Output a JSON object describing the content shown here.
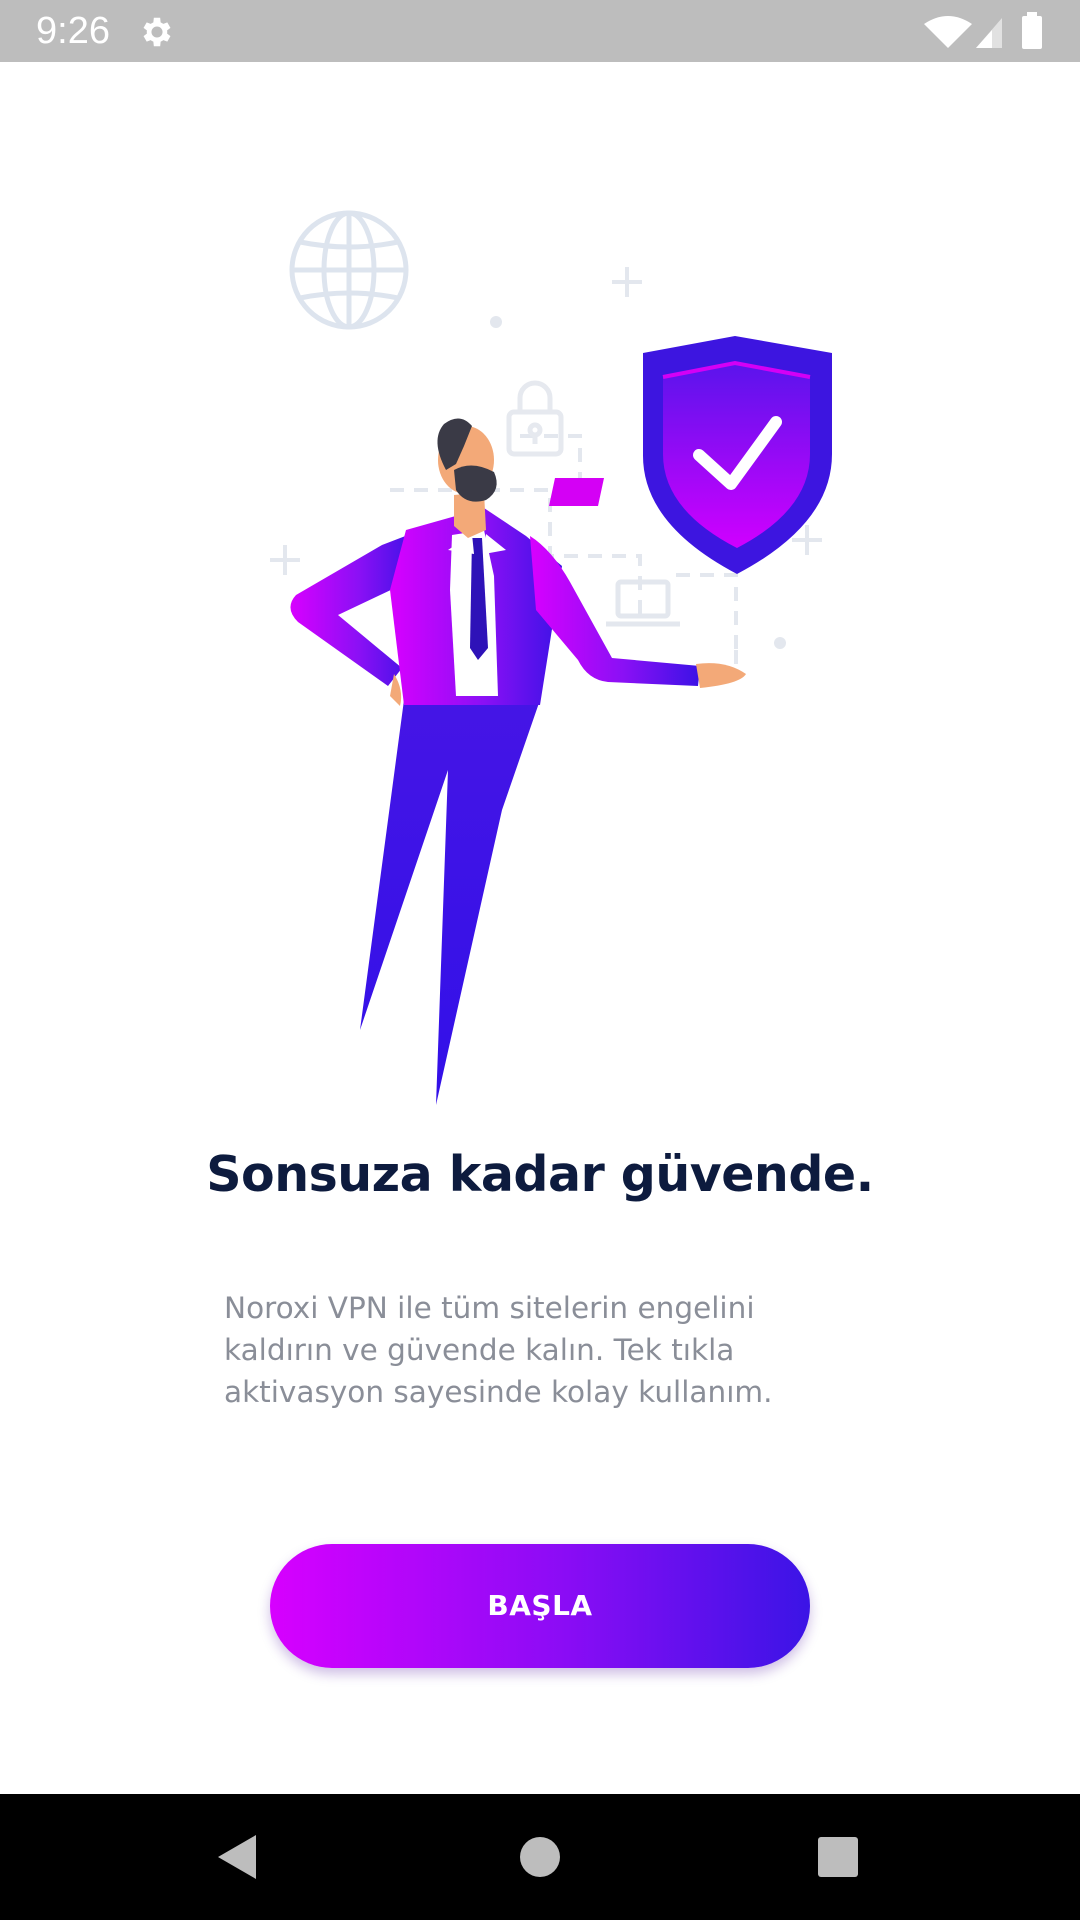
{
  "status_bar": {
    "time": "9:26",
    "icons": [
      "gear-icon",
      "wifi-icon",
      "cell-signal-icon",
      "battery-icon"
    ]
  },
  "illustration": {
    "icons": [
      "globe-icon",
      "lock-icon",
      "laptop-icon",
      "shield-check-icon",
      "person-figure"
    ]
  },
  "onboarding": {
    "headline": "Sonsuza kadar güvende.",
    "description_lines": [
      "Noroxi VPN ile tüm sitelerin engelini",
      "kaldırın ve güvende kalın. Tek tıkla",
      "aktivasyon sayesinde kolay kullanım."
    ],
    "start_button_label": "BAŞLA"
  },
  "nav_bar": {
    "buttons": [
      "back-icon",
      "home-icon",
      "recents-icon"
    ]
  },
  "colors": {
    "accent_start": "#d700ff",
    "accent_end": "#3b14e6",
    "headline": "#0d1b3e",
    "body_text": "#8a8e98"
  }
}
